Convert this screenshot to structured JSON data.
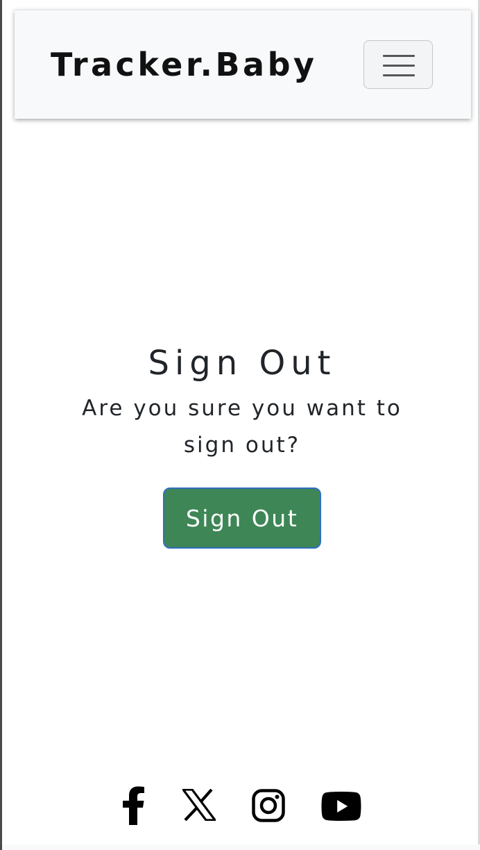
{
  "navbar": {
    "brand": "Tracker.Baby"
  },
  "icons": {
    "menu": "hamburger-icon",
    "social": [
      "facebook-icon",
      "x-icon",
      "instagram-icon",
      "youtube-icon"
    ]
  },
  "main": {
    "title": "Sign Out",
    "message": "Are you sure you want to sign out?",
    "button_label": "Sign Out"
  },
  "colors": {
    "button_bg": "#3e8656",
    "button_border": "#2f6fc1",
    "navbar_bg": "#f8f9fa",
    "text": "#212529"
  }
}
